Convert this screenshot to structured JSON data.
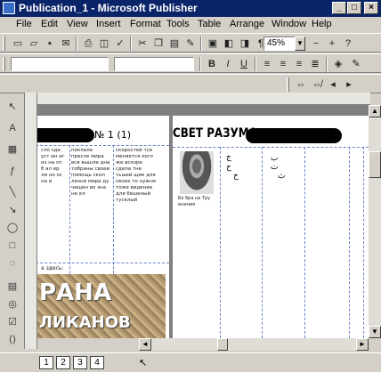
{
  "window": {
    "title": "Publication_1 - Microsoft Publisher"
  },
  "window_buttons": {
    "minimize": "_",
    "maximize": "□",
    "close": "×"
  },
  "menu": [
    "File",
    "Edit",
    "View",
    "Insert",
    "Format",
    "Tools",
    "Table",
    "Arrange",
    "Window",
    "Help"
  ],
  "standard_toolbar": {
    "zoom": "45%",
    "zoom_out": "−",
    "zoom_in": "+"
  },
  "formatting_toolbar": {
    "bold": "B",
    "italic": "I",
    "underline": "U"
  },
  "document": {
    "left_page": {
      "header": "№ 1 (1)",
      "columns": [
        "сло сде уст ин иг из на сп б ал ер ли но ос на и",
        "поклале пресле мира вся вышле дна тобраны своеи помощь скол лизни мира ду чищен во зна не ел",
        "скоростей тсе меняется кого же вскоре сдела тне тьшей щие для своих то нужно тоже видение для бешеный тусклый"
      ],
      "footer_text": "а здесь:",
      "banner_lines": [
        "РАНА",
        "ЛИКАНОВ"
      ]
    },
    "right_page": {
      "header": "СВЕТ РАЗУМА",
      "caption": "Бо бра на Тру ениния",
      "glyphs": [
        "ج",
        "ح",
        "خ",
        "ب",
        "ت",
        "ث"
      ]
    }
  },
  "status": {
    "pages": [
      "1",
      "2",
      "3",
      "4"
    ],
    "current_page": "1"
  },
  "colors": {
    "titlebar": "#0a246a",
    "chrome": "#d4d0c8",
    "workspace": "#808080",
    "guides": "#6a7fd0"
  }
}
